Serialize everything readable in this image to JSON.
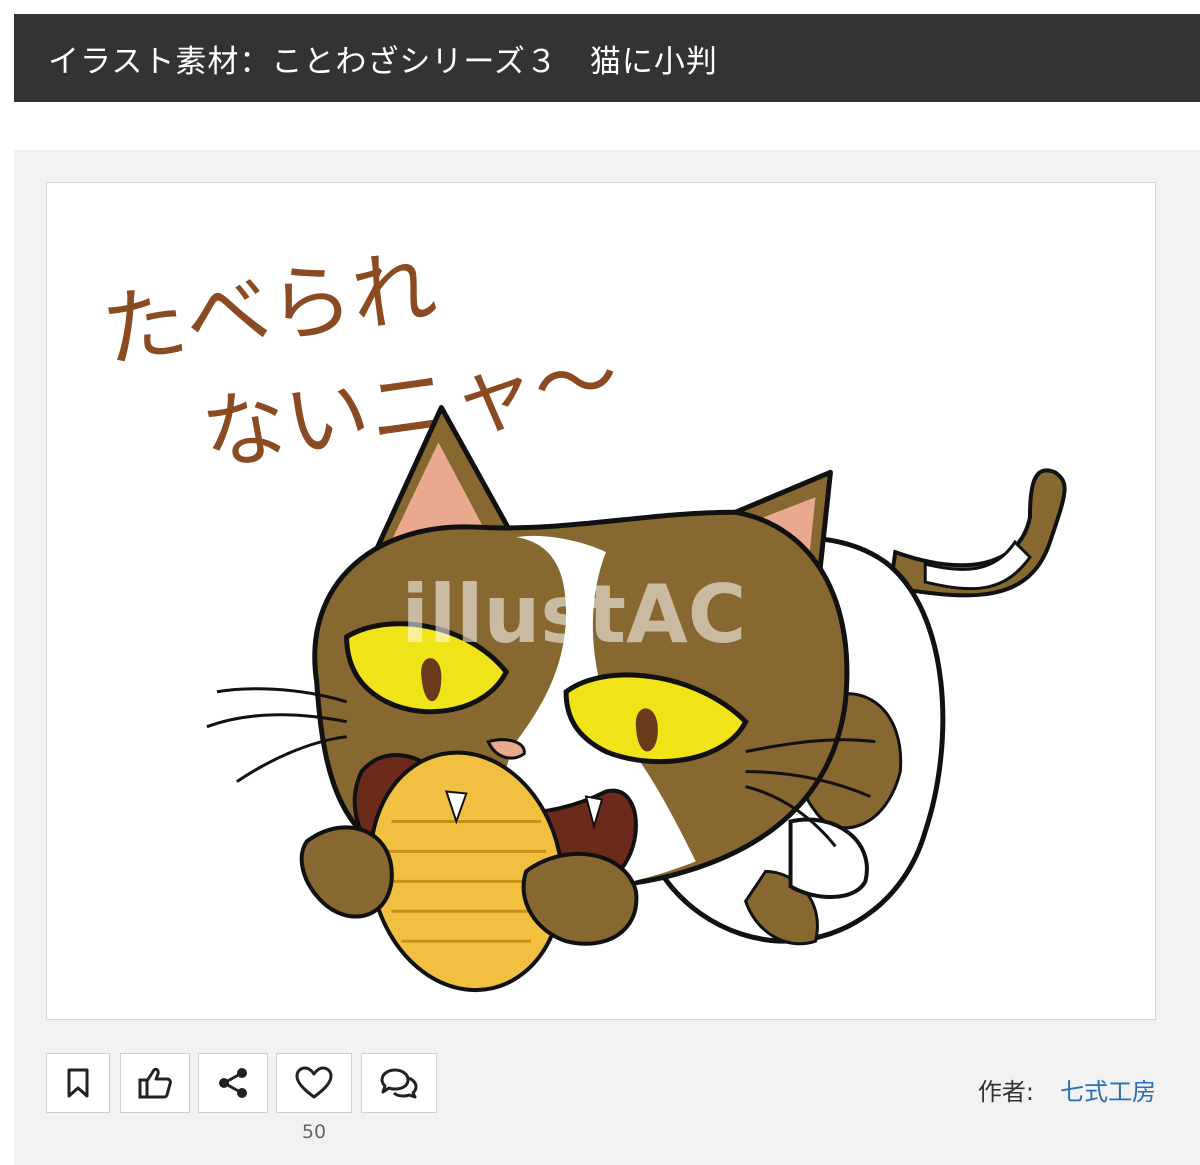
{
  "header": {
    "title": "イラスト素材：ことわざシリーズ３　猫に小判"
  },
  "illustration": {
    "caption_line1": "たべられ",
    "caption_line2": "ないニャ〜",
    "watermark": "illustAC"
  },
  "actions": {
    "bookmark_icon": "bookmark-icon",
    "thumbs_up_icon": "thumbs-up-icon",
    "share_icon": "share-icon",
    "heart_icon": "heart-icon",
    "comment_icon": "comment-icon",
    "favorite_count": "50"
  },
  "author": {
    "label": "作者:",
    "name": "七式工房"
  }
}
